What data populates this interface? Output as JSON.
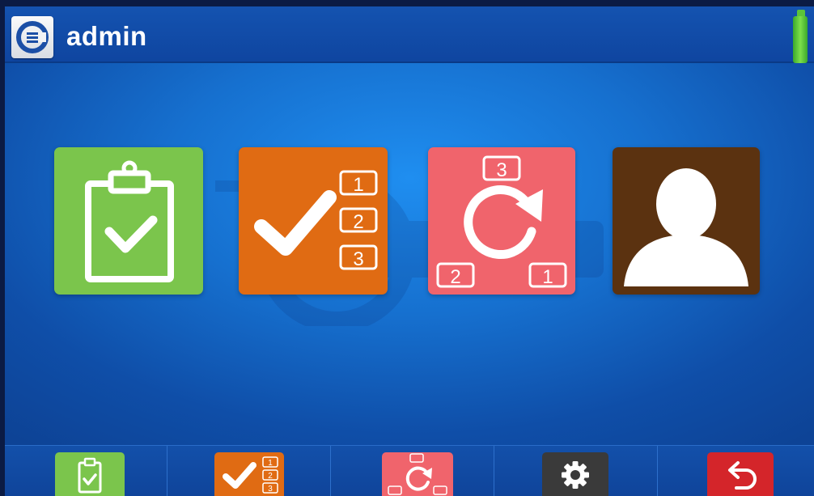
{
  "header": {
    "user_name": "admin",
    "logo_icon": "company-logo-icon",
    "battery_icon": "battery-full-icon"
  },
  "tiles": [
    {
      "name": "inspection",
      "icon": "clipboard-check-icon",
      "color": "#7bc54c"
    },
    {
      "name": "checklist",
      "icon": "numbered-checklist-icon",
      "numbers": [
        "1",
        "2",
        "3"
      ],
      "color": "#e06b13"
    },
    {
      "name": "cycle",
      "icon": "cycle-refresh-icon",
      "numbers": [
        "3",
        "2",
        "1"
      ],
      "color": "#f0646c"
    },
    {
      "name": "profile",
      "icon": "user-silhouette-icon",
      "color": "#5b3210"
    }
  ],
  "bottom_bar": [
    {
      "name": "inspection",
      "icon": "clipboard-check-icon",
      "color": "#7bc54c"
    },
    {
      "name": "checklist",
      "icon": "numbered-checklist-icon",
      "numbers": [
        "1",
        "2",
        "3"
      ],
      "color": "#e06b13"
    },
    {
      "name": "cycle",
      "icon": "cycle-refresh-icon",
      "color": "#f0646c"
    },
    {
      "name": "settings",
      "icon": "gear-icon",
      "color": "#3a3a3a"
    },
    {
      "name": "back",
      "icon": "back-arrow-icon",
      "color": "#d4252a"
    }
  ],
  "watermark": {
    "icon": "brand-watermark-icon"
  }
}
